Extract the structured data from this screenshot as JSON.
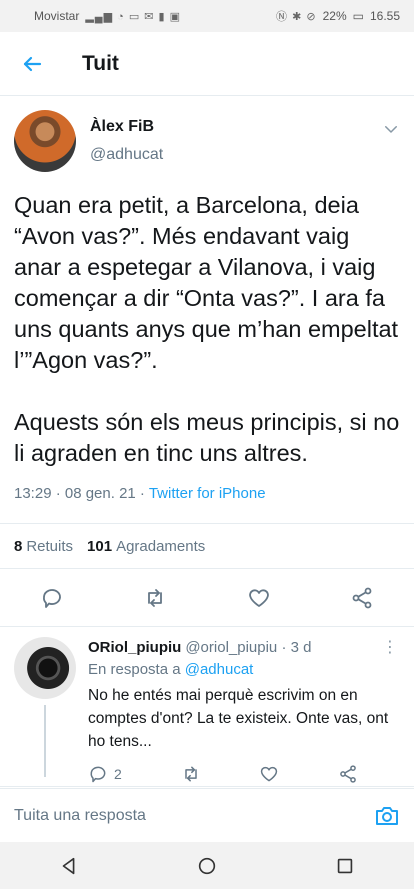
{
  "status": {
    "carrier": "Movistar",
    "battery": "22%",
    "time": "16.55"
  },
  "header": {
    "title": "Tuit"
  },
  "tweet": {
    "display_name": "Àlex FiB",
    "handle": "@adhucat",
    "text": "Quan era petit, a Barcelona, deia “Avon vas?”. Més endavant vaig anar a espetegar a Vilanova, i vaig començar a dir “Onta vas?”. I ara fa uns quants anys que m’han empeltat l’”Agon vas?”.\n\nAquests són els meus principis, si no li agraden en tinc uns altres.",
    "time": "13:29 · 08 gen. 21 · ",
    "source": "Twitter for iPhone",
    "retweets_count": "8",
    "retweets_label": "Retuits",
    "likes_count": "101",
    "likes_label": "Agradaments"
  },
  "reply": {
    "display_name": "ORiol_piupiu",
    "handle": "@oriol_piupiu",
    "age": "· 3 d",
    "reply_prefix": "En resposta a ",
    "reply_to": "@adhucat",
    "text": "No he entés mai perquè escrivim on en comptes d'ont? La te existeix. Onte vas, ont ho tens...",
    "reply_count": "2"
  },
  "compose": {
    "placeholder": "Tuita una resposta"
  }
}
